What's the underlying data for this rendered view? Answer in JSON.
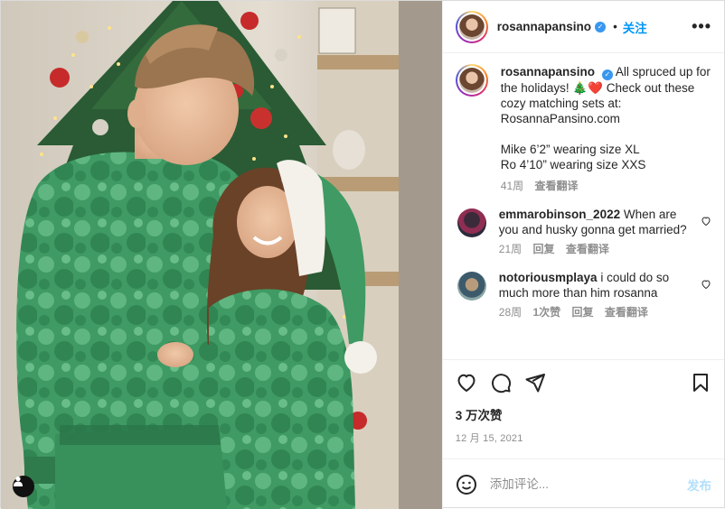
{
  "post": {
    "author": {
      "username": "rosannapansino",
      "verified": true,
      "follow_label": "关注",
      "more_label": "•••"
    },
    "caption": {
      "username": "rosannapansino",
      "text_line1": "All spruced up for the holidays! 🎄❤️ Check out these cozy matching sets at: RosannaPansino.com",
      "text_line2": "Mike 6’2” wearing size XL\nRo 4’10” wearing size XXS",
      "age": "41周",
      "translate_label": "查看翻译"
    },
    "comments": [
      {
        "username": "emmarobinson_2022",
        "text": "When are you and husky gonna get married?",
        "age": "21周",
        "reply_label": "回复",
        "translate_label": "查看翻译",
        "likes_label": ""
      },
      {
        "username": "notoriousmplaya",
        "text": "i could do so much more than him rosanna",
        "age": "28周",
        "likes_label": "1次赞",
        "reply_label": "回复",
        "translate_label": "查看翻译"
      }
    ],
    "likes": "3 万次赞",
    "date": "12 月 15, 2021",
    "add_comment": {
      "placeholder": "添加评论...",
      "post_label": "发布"
    },
    "icons": {
      "like": "heart-icon",
      "comment": "comment-icon",
      "share": "share-icon",
      "save": "bookmark-icon",
      "emoji": "emoji-icon",
      "user_tag": "user-tag-icon"
    },
    "colors": {
      "link_blue": "#0095f6",
      "post_disabled": "#b2dffc",
      "verified_blue": "#3897f0",
      "muted": "#8e8e8e",
      "pajama_green": "#3f9a63"
    }
  }
}
